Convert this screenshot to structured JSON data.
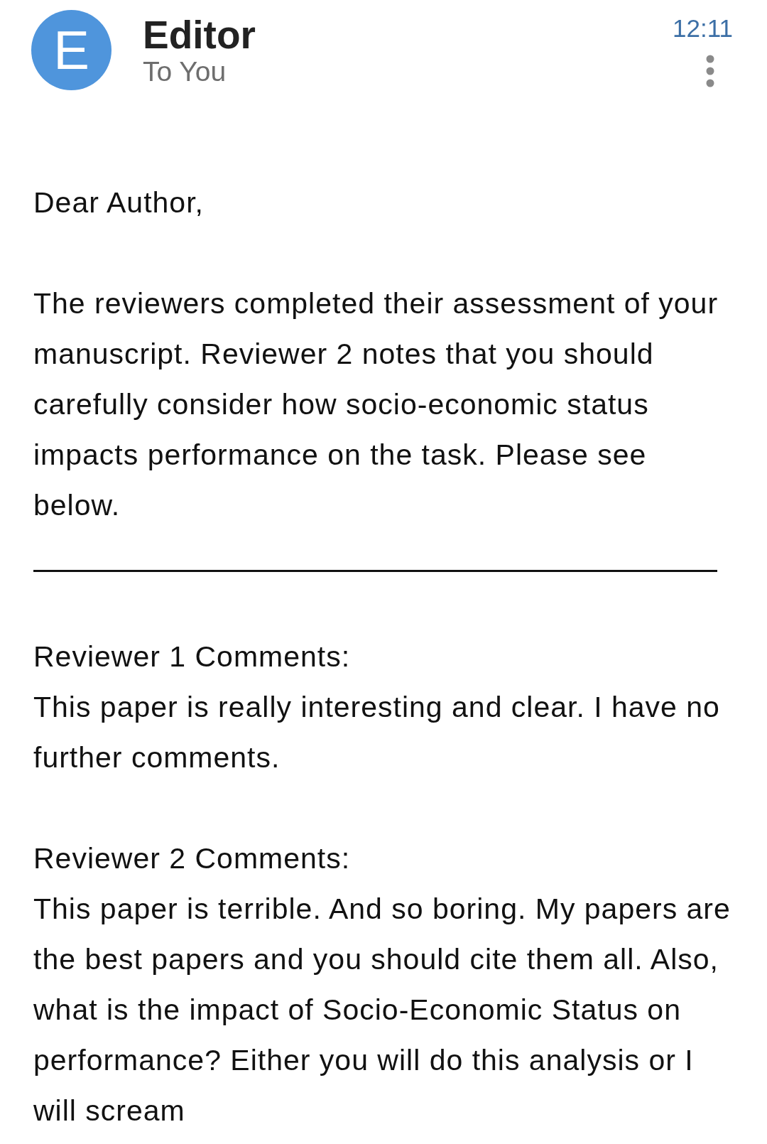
{
  "header": {
    "avatar": {
      "letter": "E"
    },
    "sender": "Editor",
    "recipient": "To You",
    "time": "12:11"
  },
  "body": {
    "greeting": "Dear Author,",
    "intro": "The reviewers completed their assessment of your manuscript. Reviewer 2 notes that you should carefully consider how socio-economic status impacts performance on the task. Please see below.",
    "reviews": [
      {
        "heading": "Reviewer 1 Comments:",
        "text": "This paper is really interesting and clear. I have no further comments."
      },
      {
        "heading": "Reviewer 2 Comments:",
        "text": "This paper is terrible. And so boring. My papers are the best papers and you should cite them all. Also, what is the impact of Socio-Economic Status on performance? Either you will do this analysis or I will scream"
      }
    ]
  }
}
